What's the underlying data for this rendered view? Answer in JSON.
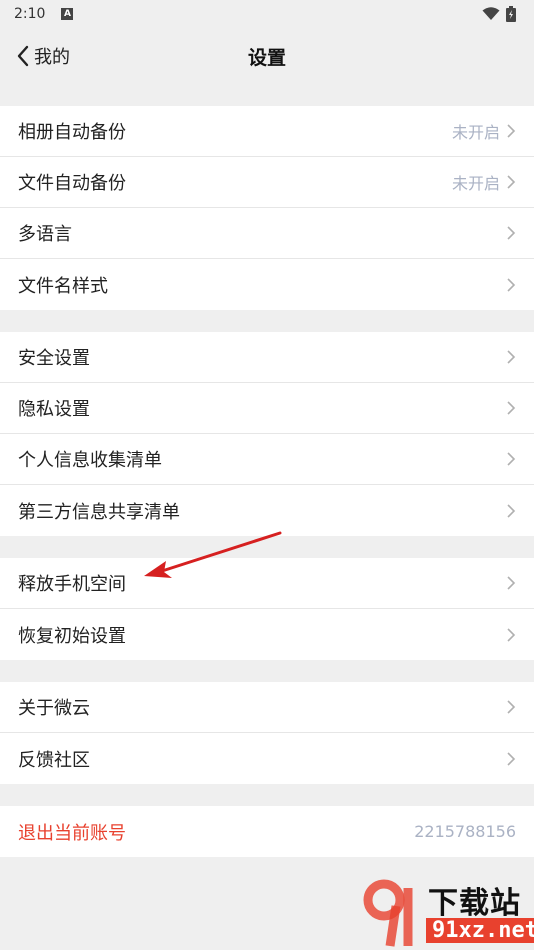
{
  "status_bar": {
    "time": "2:10",
    "notif_icon": "A"
  },
  "nav": {
    "back_label": "我的",
    "title": "设置"
  },
  "groups": [
    {
      "items": [
        {
          "label": "相册自动备份",
          "value": "未开启"
        },
        {
          "label": "文件自动备份",
          "value": "未开启"
        },
        {
          "label": "多语言",
          "value": ""
        },
        {
          "label": "文件名样式",
          "value": ""
        }
      ]
    },
    {
      "items": [
        {
          "label": "安全设置",
          "value": ""
        },
        {
          "label": "隐私设置",
          "value": ""
        },
        {
          "label": "个人信息收集清单",
          "value": ""
        },
        {
          "label": "第三方信息共享清单",
          "value": ""
        }
      ]
    },
    {
      "items": [
        {
          "label": "释放手机空间",
          "value": ""
        },
        {
          "label": "恢复初始设置",
          "value": ""
        }
      ]
    },
    {
      "items": [
        {
          "label": "关于微云",
          "value": ""
        },
        {
          "label": "反馈社区",
          "value": ""
        }
      ]
    }
  ],
  "logout": {
    "label": "退出当前账号",
    "account": "2215788156"
  },
  "colors": {
    "accent_red": "#e8412e",
    "muted_value": "#aab2c4",
    "background": "#efefef"
  },
  "watermark": {
    "brand": "下载站",
    "site": "91xz.net"
  }
}
